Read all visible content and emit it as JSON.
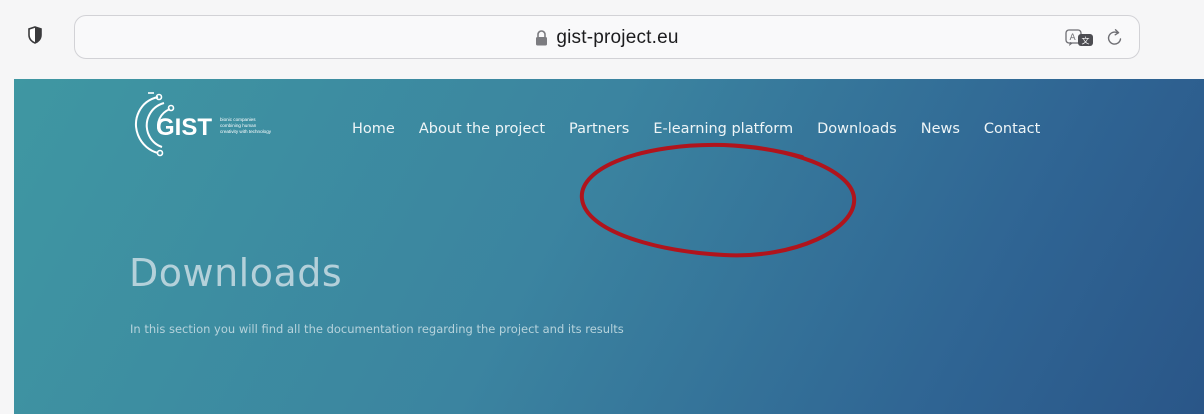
{
  "browser": {
    "url": "gist-project.eu",
    "icons": {
      "shield": "shield-icon",
      "lock": "lock-icon",
      "translate": "translate-icon",
      "reload": "reload-icon"
    }
  },
  "site": {
    "logo": {
      "wordmark": "GIST",
      "tagline": [
        "bionic companies",
        "combining human",
        "creativity with technology"
      ]
    },
    "nav": [
      {
        "label": "Home"
      },
      {
        "label": "About the project"
      },
      {
        "label": "Partners"
      },
      {
        "label": "E-learning platform"
      },
      {
        "label": "Downloads"
      },
      {
        "label": "News"
      },
      {
        "label": "Contact"
      }
    ]
  },
  "hero": {
    "title": "Downloads",
    "subtitle": "In this section you will find all the documentation regarding the project and its results"
  },
  "colors": {
    "hero_start": "#3f97a2",
    "hero_end": "#2a5688",
    "annotation": "#b0141c"
  }
}
